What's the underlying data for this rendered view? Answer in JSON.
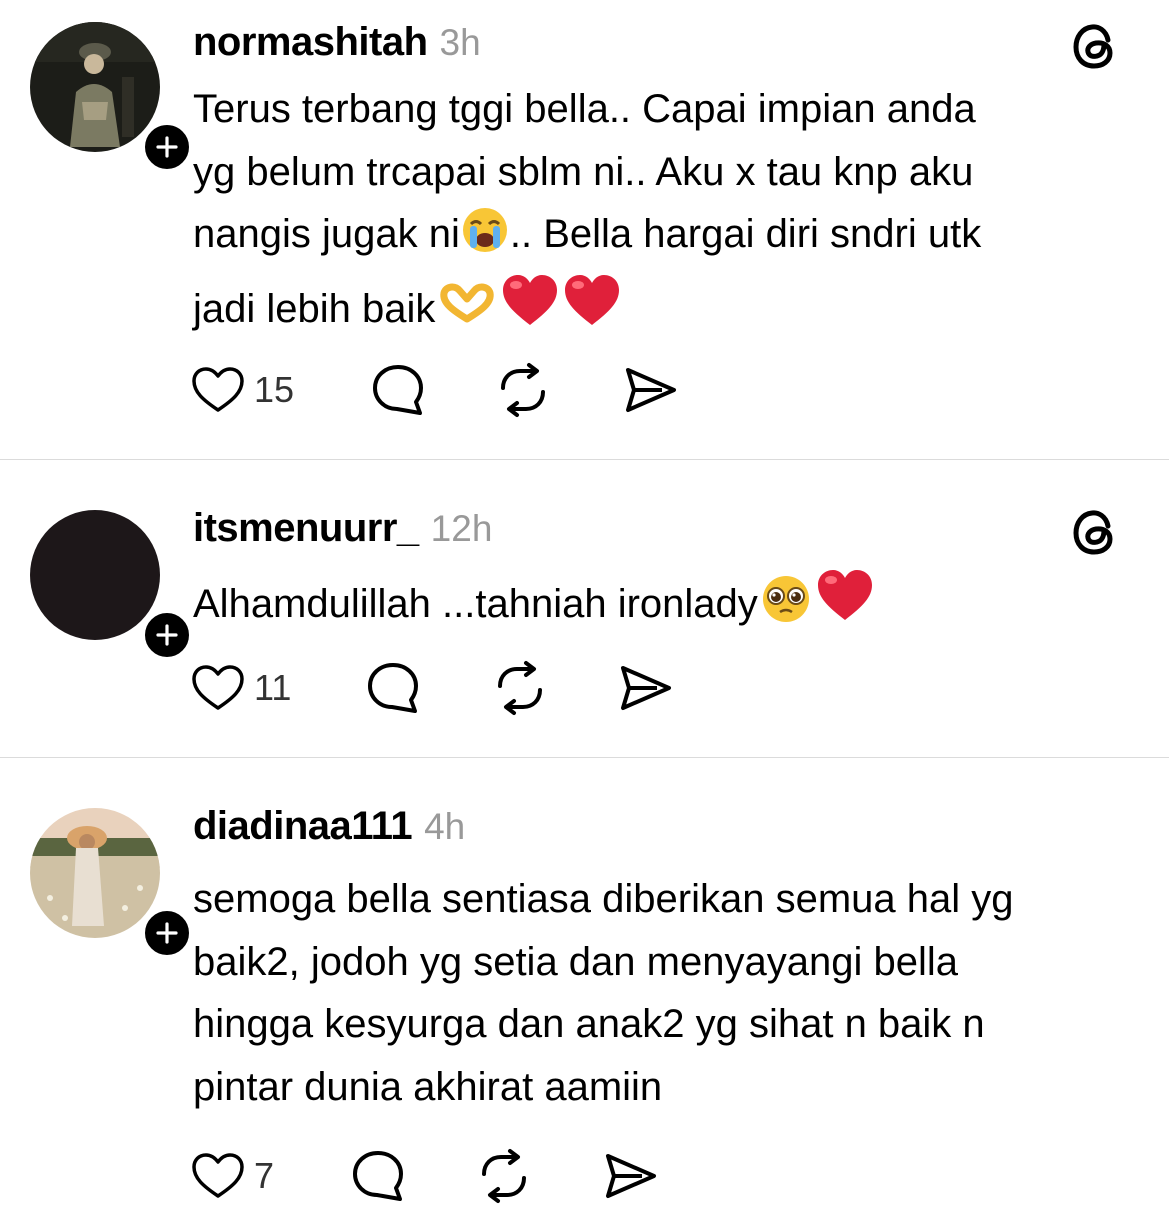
{
  "posts": [
    {
      "username": "normashitah",
      "time": "3h",
      "lines": [
        "Terus terbang tggi bella.. Capai impian anda",
        "yg belum trcapai sblm ni.. Aku x tau knp aku",
        "nangis jugak ni",
        ".. Bella hargai diri sndri utk",
        "jadi lebih baik"
      ],
      "emojis": [
        "loudly-crying-face",
        "heart-hands",
        "red-heart",
        "red-heart"
      ],
      "likes": "15"
    },
    {
      "username": "itsmenuurr_",
      "time": "12h",
      "lines": [
        "Alhamdulillah ...tahniah ironlady"
      ],
      "emojis": [
        "pleading-face",
        "red-heart"
      ],
      "likes": "11"
    },
    {
      "username": "diadinaa111",
      "time": "4h",
      "lines": [
        "semoga bella sentiasa diberikan semua hal yg",
        "baik2, jodoh yg setia dan menyayangi bella",
        "hingga kesyurga dan anak2 yg sihat n baik n",
        "pintar dunia akhirat aamiin"
      ],
      "emojis": [],
      "likes": "7"
    }
  ],
  "icons": {
    "like": "heart-outline-icon",
    "reply": "speech-bubble-icon",
    "repost": "repost-arrows-icon",
    "share": "paper-plane-icon",
    "threads": "threads-logo-icon",
    "follow": "plus-icon"
  },
  "colors": {
    "text": "#000000",
    "muted": "#999999",
    "divider": "#dbdbdb",
    "heart": "#e0203a"
  }
}
